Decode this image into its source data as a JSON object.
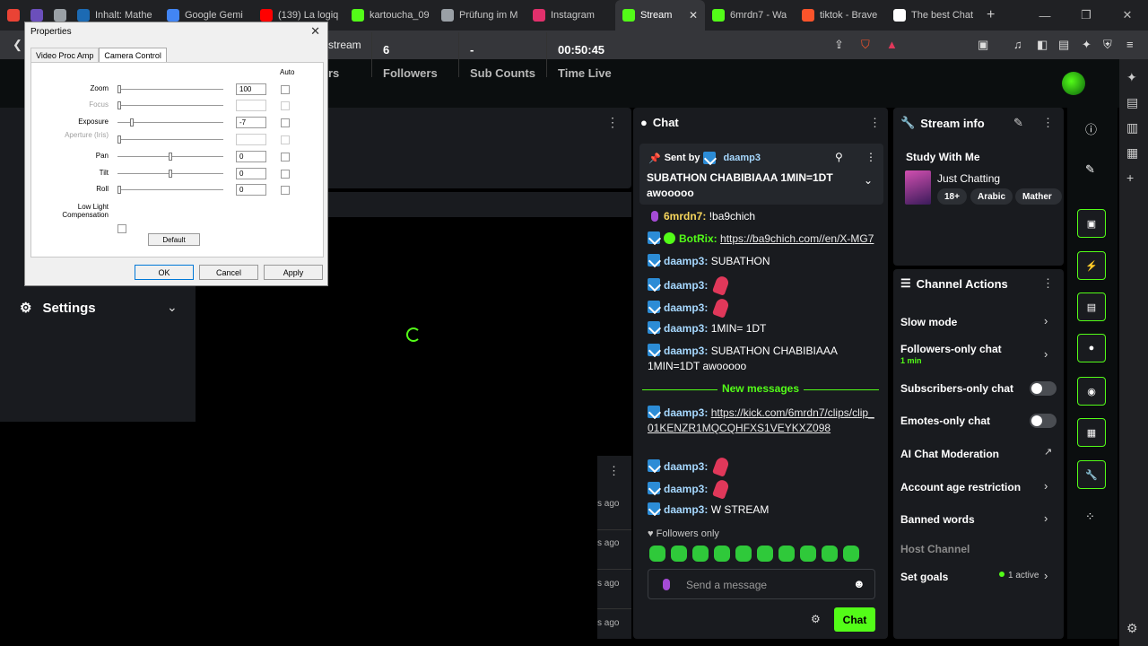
{
  "browser": {
    "tabs": [
      {
        "label": "",
        "color": "#ea4335"
      },
      {
        "label": "",
        "color": "#6b4fbb"
      },
      {
        "label": "",
        "color": "#9aa0a6"
      },
      {
        "label": "Inhalt: Mathe",
        "color": "#1c6ab3"
      },
      {
        "label": "Google Gemi",
        "color": "#4285f4"
      },
      {
        "label": "(139) La logiq",
        "color": "#ff0000"
      },
      {
        "label": "kartoucha_09",
        "color": "#53fc18"
      },
      {
        "label": "Prüfung im M",
        "color": "#9aa0a6"
      },
      {
        "label": "Instagram",
        "color": "#e1306c"
      },
      {
        "label": "Stream",
        "color": "#53fc18"
      },
      {
        "label": "6mrdn7 - Wa",
        "color": "#53fc18"
      },
      {
        "label": "tiktok - Brave",
        "color": "#fb542b"
      },
      {
        "label": "The best Chat",
        "color": "#ffffff"
      }
    ],
    "address": "stream"
  },
  "left_nav": {
    "settings_label": "Settings"
  },
  "stats": [
    {
      "value": "",
      "label": "rs"
    },
    {
      "value": "6",
      "label": "Followers"
    },
    {
      "value": "-",
      "label": "Sub Counts"
    },
    {
      "value": "00:50:45",
      "label": "Time Live"
    }
  ],
  "list_panel": {
    "ago": [
      "s ago",
      "s ago",
      "s ago",
      "s ago"
    ]
  },
  "chat": {
    "title": "Chat",
    "pinned": {
      "sent_by": "Sent by",
      "user": "daamp3",
      "message": "SUBATHON CHABIBIAAA 1MIN=1DT awooooo"
    },
    "messages": [
      {
        "user": "6mrdn7",
        "text": "!ba9chich",
        "badge": "mic",
        "color": "yellow"
      },
      {
        "user": "BotRix",
        "text": "https://ba9chich.com//en/X-MG7",
        "badge": "verified",
        "color": "green",
        "link": true
      },
      {
        "user": "daamp3",
        "text": "SUBATHON",
        "badge": "kick",
        "color": "blue"
      },
      {
        "user": "daamp3",
        "text": "",
        "badge": "kick",
        "color": "blue",
        "emote": true
      },
      {
        "user": "daamp3",
        "text": "",
        "badge": "kick",
        "color": "blue",
        "emote": true
      },
      {
        "user": "daamp3",
        "text": "1MIN= 1DT",
        "badge": "kick",
        "color": "blue"
      },
      {
        "user": "daamp3",
        "text": "SUBATHON CHABIBIAAA 1MIN=1DT awooooo",
        "badge": "kick",
        "color": "blue"
      }
    ],
    "new_messages_label": "New messages",
    "new_messages": [
      {
        "user": "daamp3",
        "text": "https://kick.com/6mrdn7/clips/clip_01KENZR1MQCQHFXS1VEYKXZ098",
        "link": true
      },
      {
        "user": "daamp3",
        "text": "",
        "emote": true
      },
      {
        "user": "daamp3",
        "text": "",
        "emote": true
      },
      {
        "user": "daamp3",
        "text": "W STREAM"
      }
    ],
    "followers_only": "Followers only",
    "placeholder": "Send a message",
    "send_label": "Chat"
  },
  "stream_info": {
    "title": "Stream info",
    "stream_title": "Study With Me",
    "category": "Just Chatting",
    "tags": [
      "18+",
      "Arabic",
      "Mather"
    ]
  },
  "channel_actions": {
    "title": "Channel Actions",
    "items": [
      {
        "label": "Slow mode"
      },
      {
        "label": "Followers-only chat",
        "sub": "1 min"
      },
      {
        "label": "Subscribers-only chat"
      },
      {
        "label": "Emotes-only chat"
      },
      {
        "label": "AI Chat Moderation"
      },
      {
        "label": "Account age restriction"
      },
      {
        "label": "Banned words"
      },
      {
        "label": "Host Channel"
      },
      {
        "label": "Set goals",
        "badge": "1 active"
      }
    ]
  },
  "dialog": {
    "title": "Properties",
    "tabs": [
      "Video Proc Amp",
      "Camera Control"
    ],
    "auto_label": "Auto",
    "properties": [
      {
        "label": "Zoom",
        "value": "100",
        "enabled": true,
        "level": 0.0
      },
      {
        "label": "Focus",
        "value": "",
        "enabled": false,
        "level": 0.0
      },
      {
        "label": "Exposure",
        "value": "-7",
        "enabled": true,
        "level": 0.12
      },
      {
        "label": "Aperture (Iris)",
        "value": "",
        "enabled": false,
        "level": 0.0
      },
      {
        "label": "Pan",
        "value": "0",
        "enabled": true,
        "level": 0.5
      },
      {
        "label": "Tilt",
        "value": "0",
        "enabled": true,
        "level": 0.5
      },
      {
        "label": "Roll",
        "value": "0",
        "enabled": true,
        "level": 0.0
      }
    ],
    "low_light_label": "Low Light Compensation",
    "default_label": "Default",
    "ok_label": "OK",
    "cancel_label": "Cancel",
    "apply_label": "Apply"
  }
}
